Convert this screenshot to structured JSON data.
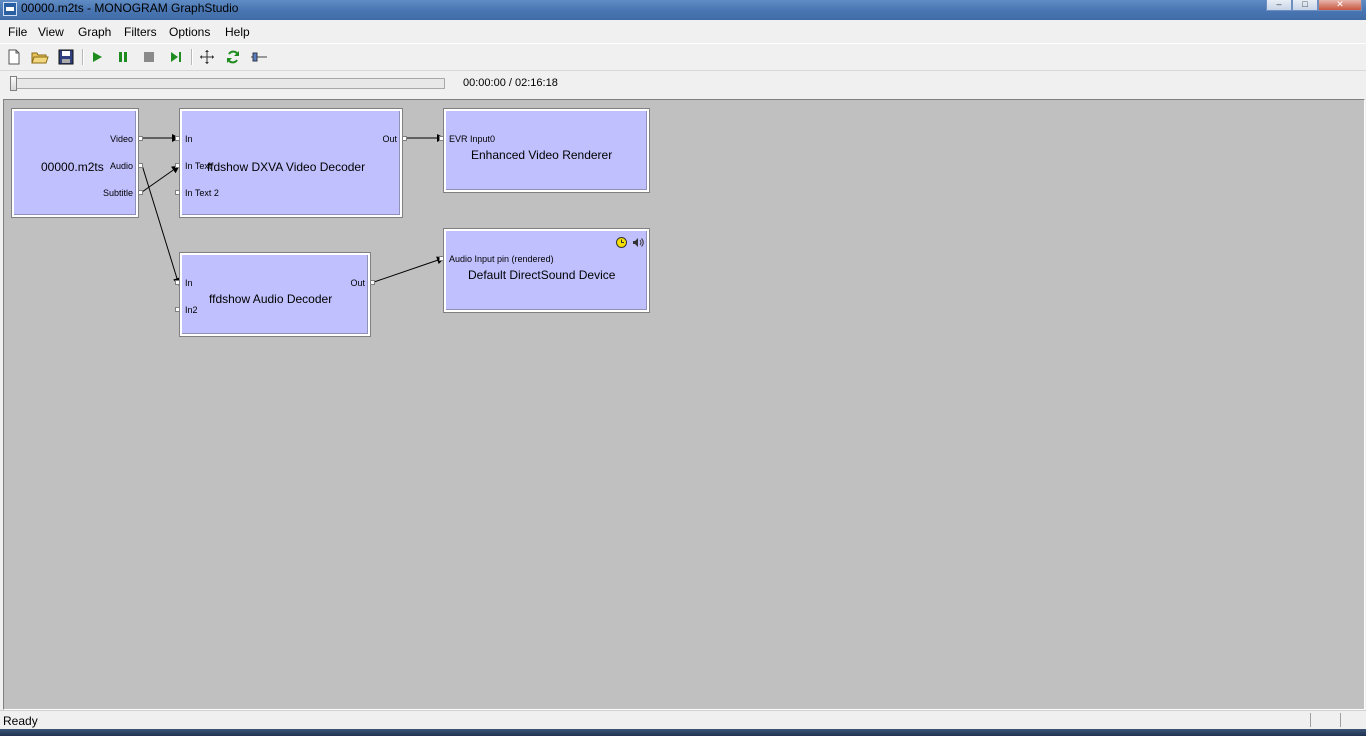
{
  "window": {
    "title": "00000.m2ts - MONOGRAM GraphStudio",
    "controls": [
      "minimize",
      "maximize",
      "close"
    ]
  },
  "menu": [
    "File",
    "View",
    "Graph",
    "Filters",
    "Options",
    "Help"
  ],
  "toolbar": {
    "buttons": [
      "new-icon",
      "open-icon",
      "save-icon",
      "play-icon",
      "pause-icon",
      "stop-icon",
      "frame-step-icon",
      "arrange-icon",
      "refresh-icon",
      "seek-icon"
    ]
  },
  "seek": {
    "time": "00:00:00 / 02:16:18",
    "position": 0
  },
  "filters": {
    "source": {
      "name": "00000.m2ts",
      "pins": [
        "Video",
        "Audio",
        "Subtitle"
      ]
    },
    "video_decoder": {
      "name": "ffdshow DXVA Video Decoder",
      "pins_in": [
        "In",
        "In Text",
        "In Text 2"
      ],
      "pins_out": [
        "Out"
      ]
    },
    "renderer": {
      "name": "Enhanced Video Renderer",
      "pins_in": [
        "EVR Input0"
      ]
    },
    "audio_decoder": {
      "name": "ffdshow Audio Decoder",
      "pins_in": [
        "In",
        "In2"
      ],
      "pins_out": [
        "Out"
      ]
    },
    "sound_device": {
      "name": "Default DirectSound Device",
      "pins_in": [
        "Audio Input pin (rendered)"
      ],
      "icons": [
        "clock-icon",
        "speaker-icon"
      ]
    }
  },
  "status": {
    "text": "Ready"
  },
  "colors": {
    "filter_fill": "#c0c0ff",
    "canvas": "#c0c0c0",
    "play_green": "#1e8c1e"
  }
}
